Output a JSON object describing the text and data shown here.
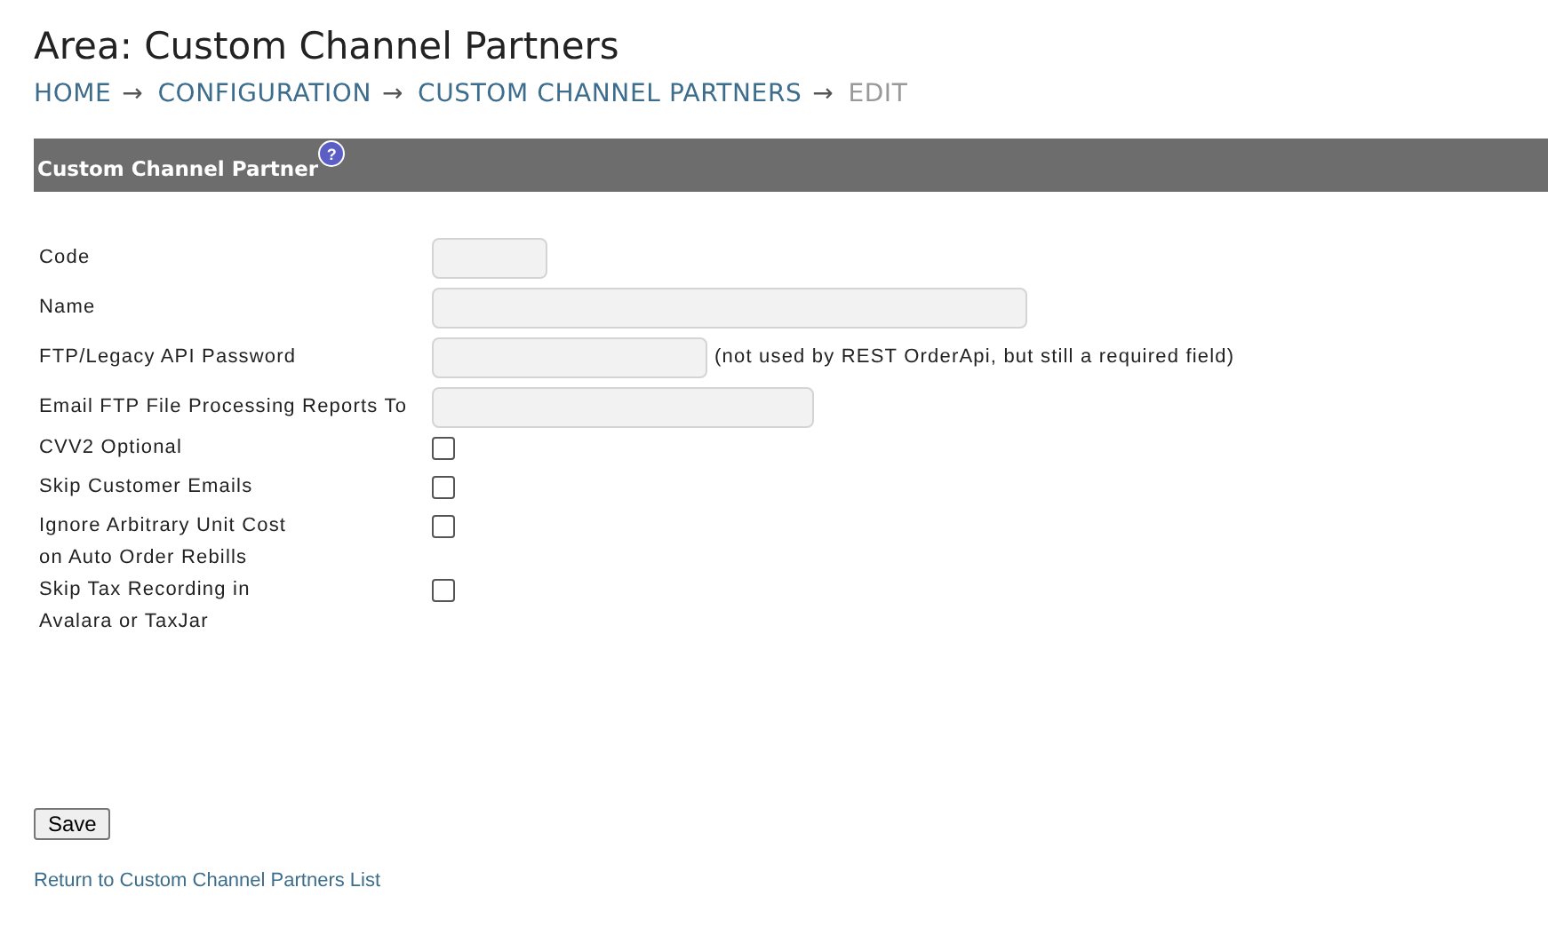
{
  "title": "Area: Custom Channel Partners",
  "breadcrumb": [
    {
      "label": "HOME",
      "arrow": "→",
      "current": false
    },
    {
      "label": "CONFIGURATION",
      "arrow": "→",
      "current": false
    },
    {
      "label": "CUSTOM CHANNEL PARTNERS",
      "arrow": "→",
      "current": false
    },
    {
      "label": "EDIT",
      "current": true
    }
  ],
  "panel": {
    "title": "Custom Channel Partner",
    "help": "?"
  },
  "fields": [
    {
      "kind": "text",
      "label": "Code"
    },
    {
      "kind": "text",
      "label": "Name"
    },
    {
      "kind": "text",
      "label": "FTP/Legacy API Password",
      "note": "(not used by REST OrderApi, but still a required field)"
    },
    {
      "kind": "text",
      "label": "Email FTP File Processing Reports To"
    },
    {
      "kind": "checkbox",
      "label": "CVV2 Optional",
      "checked": false
    },
    {
      "kind": "checkbox",
      "label": "Skip Customer Emails",
      "checked": false
    },
    {
      "kind": "checkbox",
      "label": "Ignore Arbitrary Unit Cost\non Auto Order Rebills",
      "checked": false
    },
    {
      "kind": "checkbox",
      "label": "Skip Tax Recording in\nAvalara or TaxJar",
      "checked": false
    }
  ],
  "save_button": "Save",
  "return_link": "Return to Custom Channel Partners List"
}
